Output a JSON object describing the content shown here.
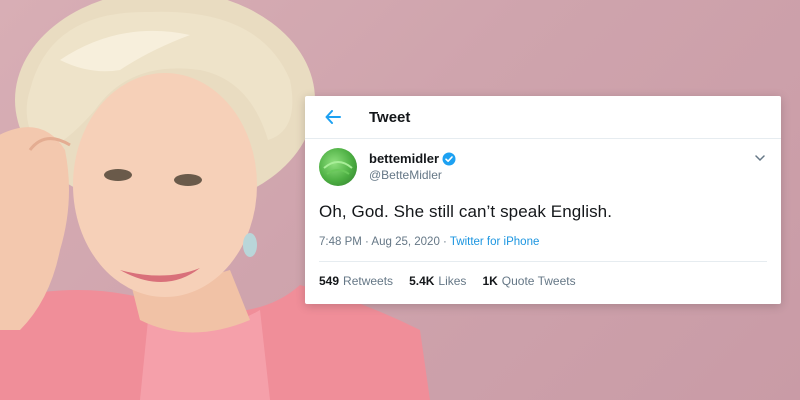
{
  "header": {
    "title": "Tweet"
  },
  "author": {
    "display_name": "bettemidler",
    "handle": "@BetteMidler",
    "verified": true
  },
  "tweet": {
    "text": "Oh, God.  She still can’t speak English.",
    "time": "7:48 PM",
    "date": "Aug 25, 2020",
    "source": "Twitter for iPhone"
  },
  "stats": [
    {
      "count": "549",
      "label": "Retweets"
    },
    {
      "count": "5.4K",
      "label": "Likes"
    },
    {
      "count": "1K",
      "label": "Quote Tweets"
    }
  ],
  "colors": {
    "accent": "#1b95e0",
    "background": "#d1a6af",
    "text": "#14171a",
    "muted": "#657786"
  },
  "icons": [
    "arrow-left-icon",
    "verified-badge-icon",
    "chevron-down-icon"
  ]
}
